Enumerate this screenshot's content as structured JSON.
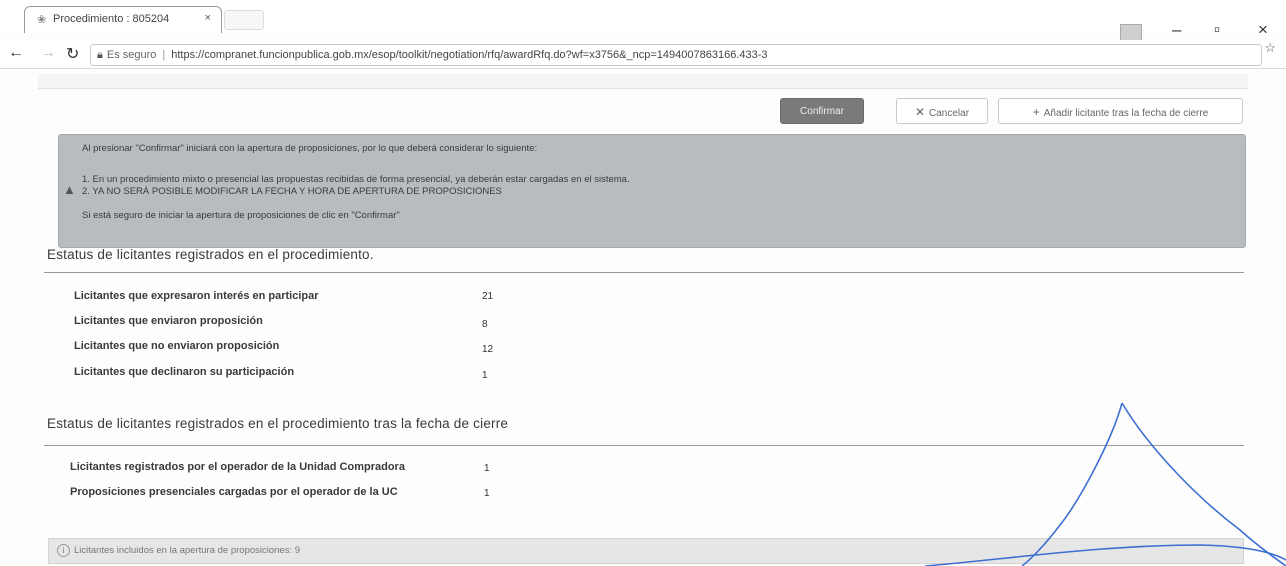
{
  "browser": {
    "tab_title": "Procedimiento : 805204",
    "tab_close": "×",
    "secure_label": "Es seguro",
    "url": "https://compranet.funcionpublica.gob.mx/esop/toolkit/negotiation/rfq/awardRfq.do?wf=x3756&_ncp=1494007863166.433-3"
  },
  "actions": {
    "confirm_label": "Confirmar",
    "cancel_label": "Cancelar",
    "add_label": "Añadir licitante tras la fecha de cierre"
  },
  "alert": {
    "intro": "Al presionar \"Confirmar\" iniciará con la apertura de proposiciones, por lo que deberá considerar lo siguiente:",
    "item1": "1. En un procedimiento mixto o presencial las propuestas recibidas de forma presencial, ya deberán estar cargadas en el sistema.",
    "item2": "2. YA NO SERÁ POSIBLE MODIFICAR LA FECHA Y HORA DE APERTURA DE PROPOSICIONES",
    "outro": "Si está seguro de iniciar la apertura de proposiciones de clic en \"Confirmar\""
  },
  "section1": {
    "title": "Estatus de licitantes registrados en el procedimiento.",
    "rows": [
      {
        "label": "Licitantes que expresaron interés en participar",
        "value": "21"
      },
      {
        "label": "Licitantes que enviaron proposición",
        "value": "8"
      },
      {
        "label": "Licitantes que no enviaron proposición",
        "value": "12"
      },
      {
        "label": "Licitantes que declinaron su participación",
        "value": "1"
      }
    ]
  },
  "section2": {
    "title": "Estatus de licitantes registrados en el procedimiento tras la fecha de cierre",
    "rows": [
      {
        "label": "Licitantes registrados por el operador de la Unidad Compradora",
        "value": "1"
      },
      {
        "label": "Proposiciones presenciales cargadas por el operador de la UC",
        "value": "1"
      }
    ]
  },
  "footer": {
    "info_text": "Licitantes incluidos en la apertura de proposiciones: 9"
  },
  "colors": {
    "alert_bg": "#b9bcbf",
    "confirm_bg": "#7a7a7a",
    "signature_ink": "#3d6fd1"
  }
}
